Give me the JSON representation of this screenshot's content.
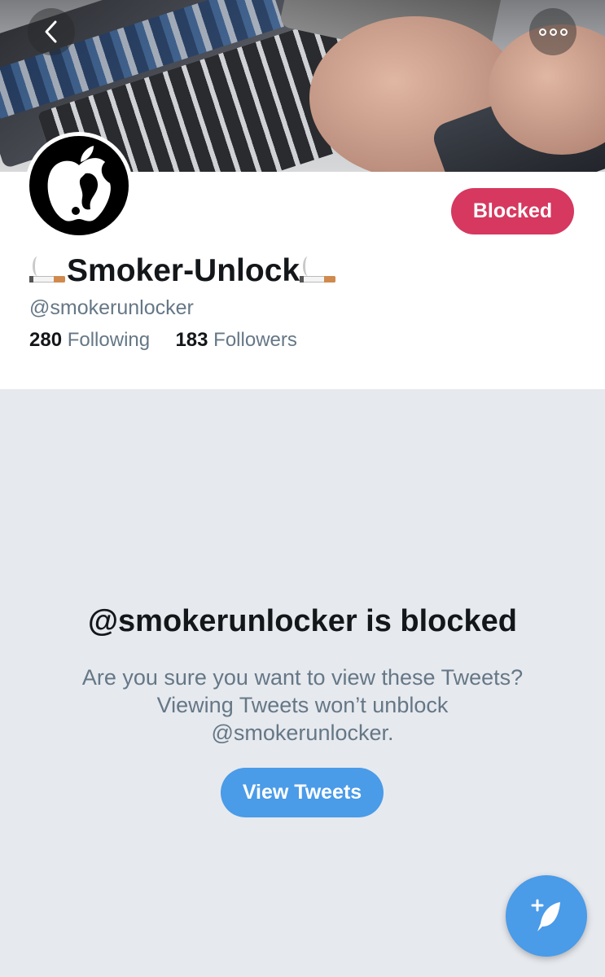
{
  "profile": {
    "display_name": "Smoker-Unlock",
    "handle": "@smokerunlocker",
    "following_count": "280",
    "following_label": "Following",
    "followers_count": "183",
    "followers_label": "Followers",
    "blocked_button_label": "Blocked"
  },
  "blocked_notice": {
    "title": "@smokerunlocker is blocked",
    "line1": "Are you sure you want to view these Tweets?",
    "line2": "Viewing Tweets won’t unblock",
    "line3": "@smokerunlocker.",
    "button_label": "View Tweets"
  },
  "icons": {
    "back": "chevron-left-icon",
    "more": "more-options-icon",
    "compose": "compose-tweet-icon",
    "name_emoji": "cigarette-icon"
  },
  "colors": {
    "blocked_button": "#d6385f",
    "primary_button": "#4a9be8",
    "muted_text": "#657786",
    "background": "#e6e9ee"
  }
}
